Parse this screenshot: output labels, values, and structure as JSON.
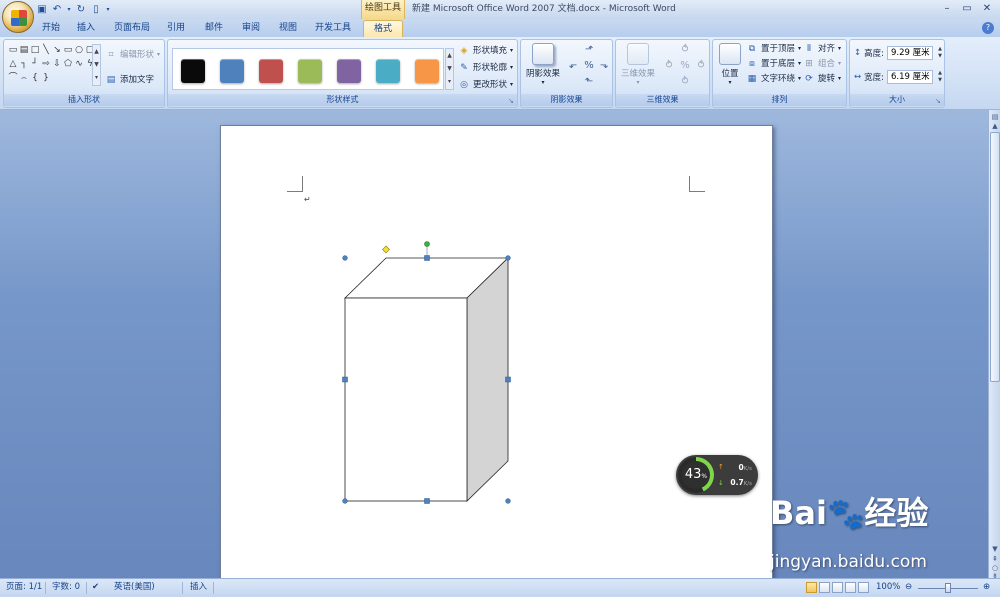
{
  "app": {
    "context_tab_group": "绘图工具",
    "window_title": "新建 Microsoft Office Word 2007 文档.docx - Microsoft Word"
  },
  "quick_access": [
    "save-icon",
    "undo-icon",
    "redo-icon",
    "new-doc-icon",
    "customize-icon"
  ],
  "tabs": [
    {
      "label": "开始",
      "active": false
    },
    {
      "label": "插入",
      "active": false
    },
    {
      "label": "页面布局",
      "active": false
    },
    {
      "label": "引用",
      "active": false
    },
    {
      "label": "邮件",
      "active": false
    },
    {
      "label": "审阅",
      "active": false
    },
    {
      "label": "视图",
      "active": false
    },
    {
      "label": "开发工具",
      "active": false
    },
    {
      "label": "格式",
      "active": true
    }
  ],
  "ribbon": {
    "insert_shapes": {
      "label": "插入形状",
      "edit_shape": "编辑形状",
      "add_text": "添加文字"
    },
    "shape_styles": {
      "label": "形状样式",
      "swatches": [
        "#0a0a0a",
        "#4f81bd",
        "#c0504d",
        "#9bbb59",
        "#8064a2",
        "#4bacc6",
        "#f79646"
      ],
      "fill": "形状填充",
      "outline": "形状轮廓",
      "change_shape": "更改形状"
    },
    "shadow": {
      "label": "阴影效果",
      "button": "阴影效果"
    },
    "three_d": {
      "label": "三维效果",
      "button": "三维效果"
    },
    "arrange": {
      "label": "排列",
      "position": "位置",
      "bring_front": "置于顶层",
      "send_back": "置于底层",
      "text_wrap": "文字环绕",
      "align": "对齐",
      "group": "组合",
      "rotate": "旋转"
    },
    "size": {
      "label": "大小",
      "height_label": "高度:",
      "height_value": "9.29 厘米",
      "width_label": "宽度:",
      "width_value": "6.19 厘米"
    }
  },
  "speed_widget": {
    "percent": "43",
    "percent_unit": "%",
    "upload": "0",
    "download": "0.7",
    "unit": "K/s",
    "load_fraction": 0.43
  },
  "watermark": {
    "logo": "Bai",
    "logo_cn": "经验",
    "url": "jingyan.baidu.com"
  },
  "statusbar": {
    "page": "页面: 1/1",
    "words": "字数: 0",
    "language": "英语(美国)",
    "mode": "插入",
    "zoom": "100%"
  },
  "colors": {
    "selection_handle": "#4f81bd",
    "rotate_handle": "#3cb043",
    "adjust_handle": "#f2e032",
    "box_side": "#d4d4d4"
  }
}
